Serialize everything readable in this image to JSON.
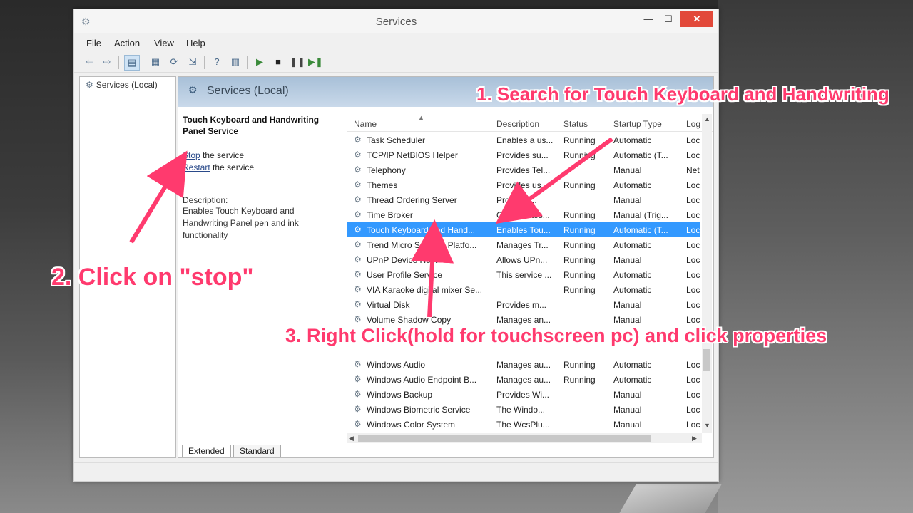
{
  "window": {
    "title": "Services",
    "controls": {
      "minimize": "—",
      "maximize": "☐",
      "close": "✕"
    }
  },
  "menu": [
    "File",
    "Action",
    "View",
    "Help"
  ],
  "tree": {
    "root_label": "Services (Local)"
  },
  "pane": {
    "header": "Services (Local)"
  },
  "details": {
    "service_name": "Touch Keyboard and Handwriting Panel Service",
    "stop_link": "Stop",
    "stop_rest": " the service",
    "restart_link": "Restart",
    "restart_rest": " the service",
    "description_label": "Description:",
    "description_text": "Enables Touch Keyboard and Handwriting Panel pen and ink functionality"
  },
  "list": {
    "columns": {
      "name": "Name",
      "description": "Description",
      "status": "Status",
      "startup": "Startup Type",
      "logon": "Log"
    },
    "rows": [
      {
        "name": "Task Scheduler",
        "desc": "Enables a us...",
        "status": "Running",
        "startup": "Automatic",
        "log": "Loc"
      },
      {
        "name": "TCP/IP NetBIOS Helper",
        "desc": "Provides su...",
        "status": "Running",
        "startup": "Automatic (T...",
        "log": "Loc"
      },
      {
        "name": "Telephony",
        "desc": "Provides Tel...",
        "status": "",
        "startup": "Manual",
        "log": "Net"
      },
      {
        "name": "Themes",
        "desc": "Provides us...",
        "status": "Running",
        "startup": "Automatic",
        "log": "Loc"
      },
      {
        "name": "Thread Ordering Server",
        "desc": "Provides...",
        "status": "",
        "startup": "Manual",
        "log": "Loc"
      },
      {
        "name": "Time Broker",
        "desc": "Coordinates...",
        "status": "Running",
        "startup": "Manual (Trig...",
        "log": "Loc"
      },
      {
        "name": "Touch Keyboard and Hand...",
        "desc": "Enables Tou...",
        "status": "Running",
        "startup": "Automatic (T...",
        "log": "Loc",
        "selected": true
      },
      {
        "name": "Trend Micro Solution Platfo...",
        "desc": "Manages Tr...",
        "status": "Running",
        "startup": "Automatic",
        "log": "Loc"
      },
      {
        "name": "UPnP Device Host",
        "desc": "Allows UPn...",
        "status": "Running",
        "startup": "Manual",
        "log": "Loc"
      },
      {
        "name": "User Profile Service",
        "desc": "This service ...",
        "status": "Running",
        "startup": "Automatic",
        "log": "Loc"
      },
      {
        "name": "VIA Karaoke digital mixer Se...",
        "desc": "",
        "status": "Running",
        "startup": "Automatic",
        "log": "Loc"
      },
      {
        "name": "Virtual Disk",
        "desc": "Provides m...",
        "status": "",
        "startup": "Manual",
        "log": "Loc"
      },
      {
        "name": "Volume Shadow Copy",
        "desc": "Manages an...",
        "status": "",
        "startup": "Manual",
        "log": "Loc"
      },
      {
        "name": "",
        "desc": "",
        "status": "",
        "startup": "",
        "log": ""
      },
      {
        "name": "",
        "desc": "",
        "status": "",
        "startup": "",
        "log": ""
      },
      {
        "name": "Windows Audio",
        "desc": "Manages au...",
        "status": "Running",
        "startup": "Automatic",
        "log": "Loc"
      },
      {
        "name": "Windows Audio Endpoint B...",
        "desc": "Manages au...",
        "status": "Running",
        "startup": "Automatic",
        "log": "Loc"
      },
      {
        "name": "Windows Backup",
        "desc": "Provides Wi...",
        "status": "",
        "startup": "Manual",
        "log": "Loc"
      },
      {
        "name": "Windows Biometric Service",
        "desc": "The Windo...",
        "status": "",
        "startup": "Manual",
        "log": "Loc"
      },
      {
        "name": "Windows Color System",
        "desc": "The WcsPlu...",
        "status": "",
        "startup": "Manual",
        "log": "Loc"
      }
    ]
  },
  "tabs": [
    "Extended",
    "Standard"
  ],
  "annotations": {
    "step1": "1. Search for Touch Keyboard and Handwriting",
    "step2": "2. Click on \"stop\"",
    "step3": "3. Right Click(hold for touchscreen pc) and click properties"
  },
  "colors": {
    "annotation": "#ff3a6e",
    "selection": "#3399ff",
    "header": "#a8c0d8"
  }
}
